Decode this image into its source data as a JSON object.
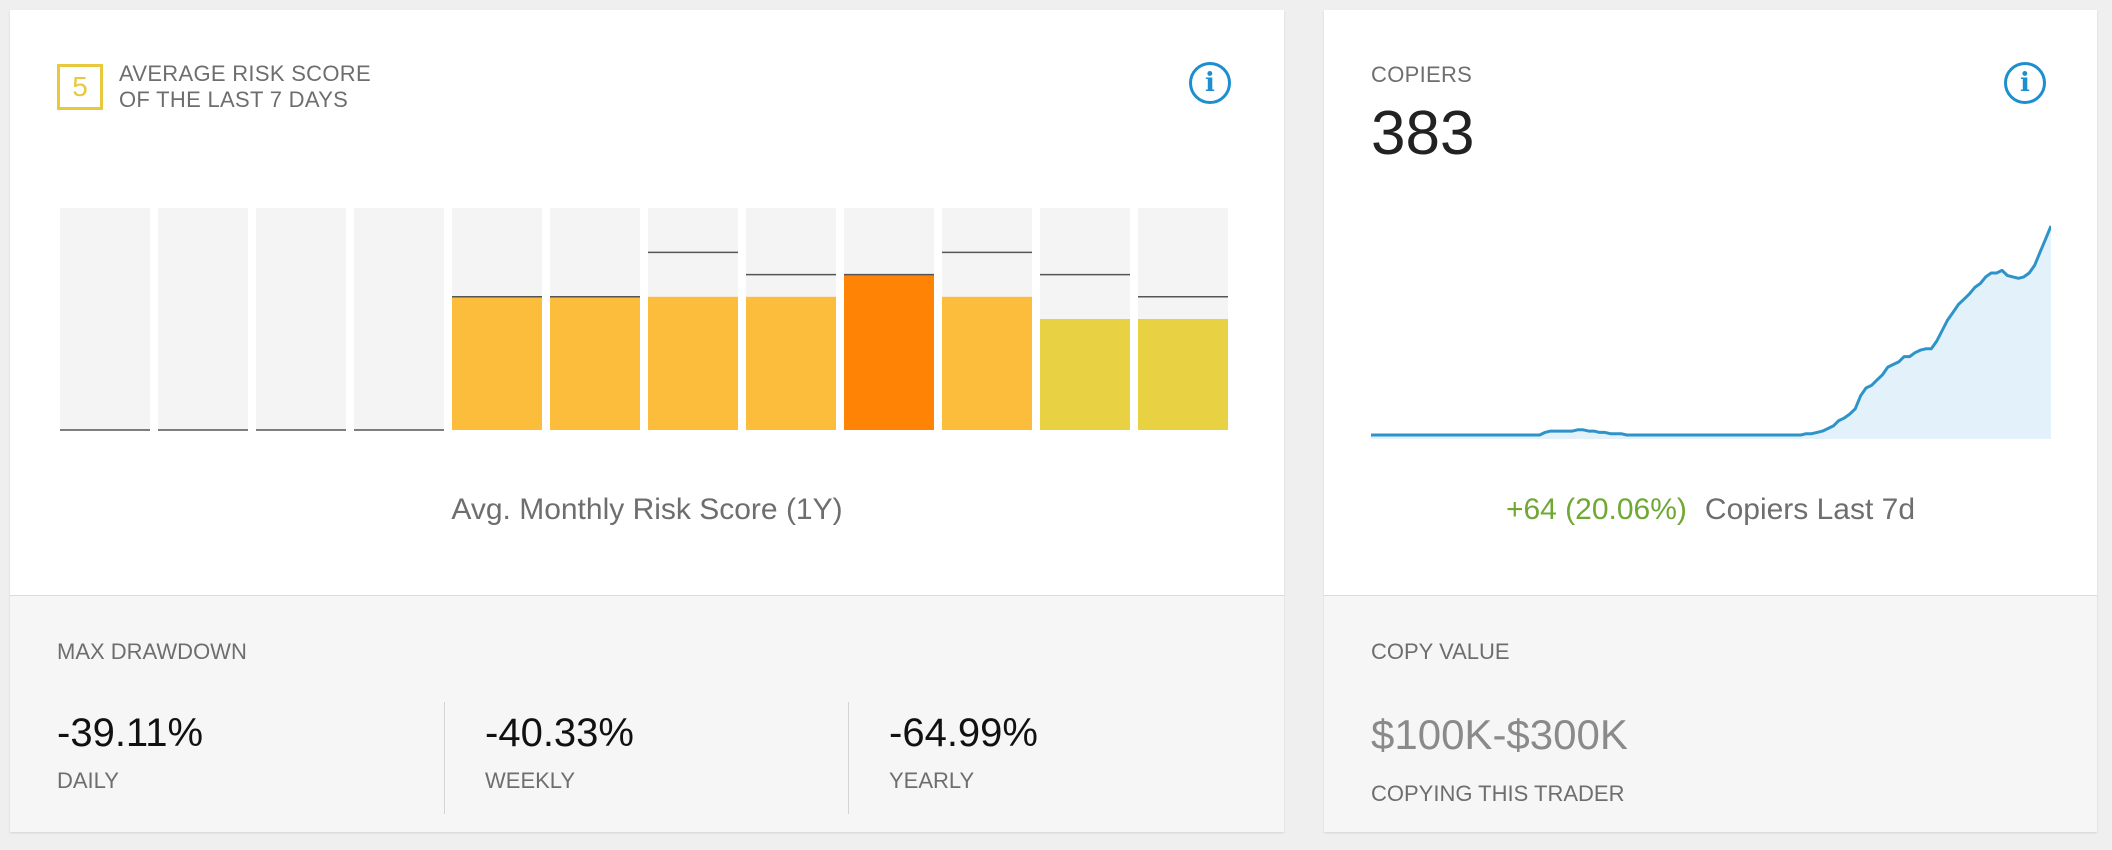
{
  "risk_card": {
    "score": "5",
    "title_line1": "AVERAGE RISK SCORE",
    "title_line2": "OF THE LAST 7 DAYS",
    "caption": "Avg. Monthly Risk Score (1Y)"
  },
  "max_drawdown": {
    "label": "MAX DRAWDOWN",
    "items": [
      {
        "value": "-39.11%",
        "label": "DAILY"
      },
      {
        "value": "-40.33%",
        "label": "WEEKLY"
      },
      {
        "value": "-64.99%",
        "label": "YEARLY"
      }
    ]
  },
  "copiers_card": {
    "label": "COPIERS",
    "count": "383",
    "change": "+64 (20.06%)",
    "caption": "Copiers Last 7d"
  },
  "copy_value": {
    "label": "COPY VALUE",
    "value": "$100K-$300K",
    "sub": "COPYING THIS TRADER"
  },
  "colors": {
    "accent": "#1d8fce",
    "risk_5": "#e8d244",
    "risk_6": "#fcbd3c",
    "risk_7": "#ff8406",
    "positive": "#6fa833"
  },
  "chart_data": [
    {
      "type": "bar",
      "title": "Avg. Monthly Risk Score (1Y)",
      "ylim": [
        0,
        10
      ],
      "values": [
        0,
        0,
        0,
        0,
        6,
        6,
        6,
        6,
        7,
        6,
        5,
        5
      ],
      "max_values": [
        0,
        0,
        0,
        0,
        6,
        6,
        8,
        7,
        7,
        8,
        7,
        6
      ]
    },
    {
      "type": "area",
      "title": "Copiers Last 7d",
      "values": [
        0,
        0,
        0,
        0,
        0,
        0,
        0,
        0,
        0,
        0,
        0,
        0,
        0,
        0,
        0,
        0,
        0,
        0,
        0,
        0,
        0,
        0,
        0,
        0,
        0,
        0,
        0,
        0,
        0,
        0,
        0,
        0,
        2,
        3,
        3,
        3,
        3,
        3,
        4,
        4,
        3,
        3,
        2,
        2,
        1,
        1,
        1,
        0,
        0,
        0,
        0,
        0,
        0,
        0,
        0,
        0,
        0,
        0,
        0,
        0,
        0,
        0,
        0,
        0,
        0,
        0,
        0,
        0,
        0,
        0,
        0,
        0,
        0,
        0,
        0,
        0,
        0,
        0,
        0,
        0,
        1,
        1,
        2,
        3,
        5,
        7,
        11,
        13,
        16,
        20,
        30,
        36,
        38,
        42,
        46,
        52,
        54,
        56,
        60,
        60,
        63,
        65,
        66,
        66,
        72,
        80,
        88,
        94,
        100,
        104,
        108,
        113,
        116,
        121,
        124,
        124,
        126,
        122,
        121,
        120,
        121,
        124,
        130,
        140,
        150,
        160
      ]
    }
  ]
}
